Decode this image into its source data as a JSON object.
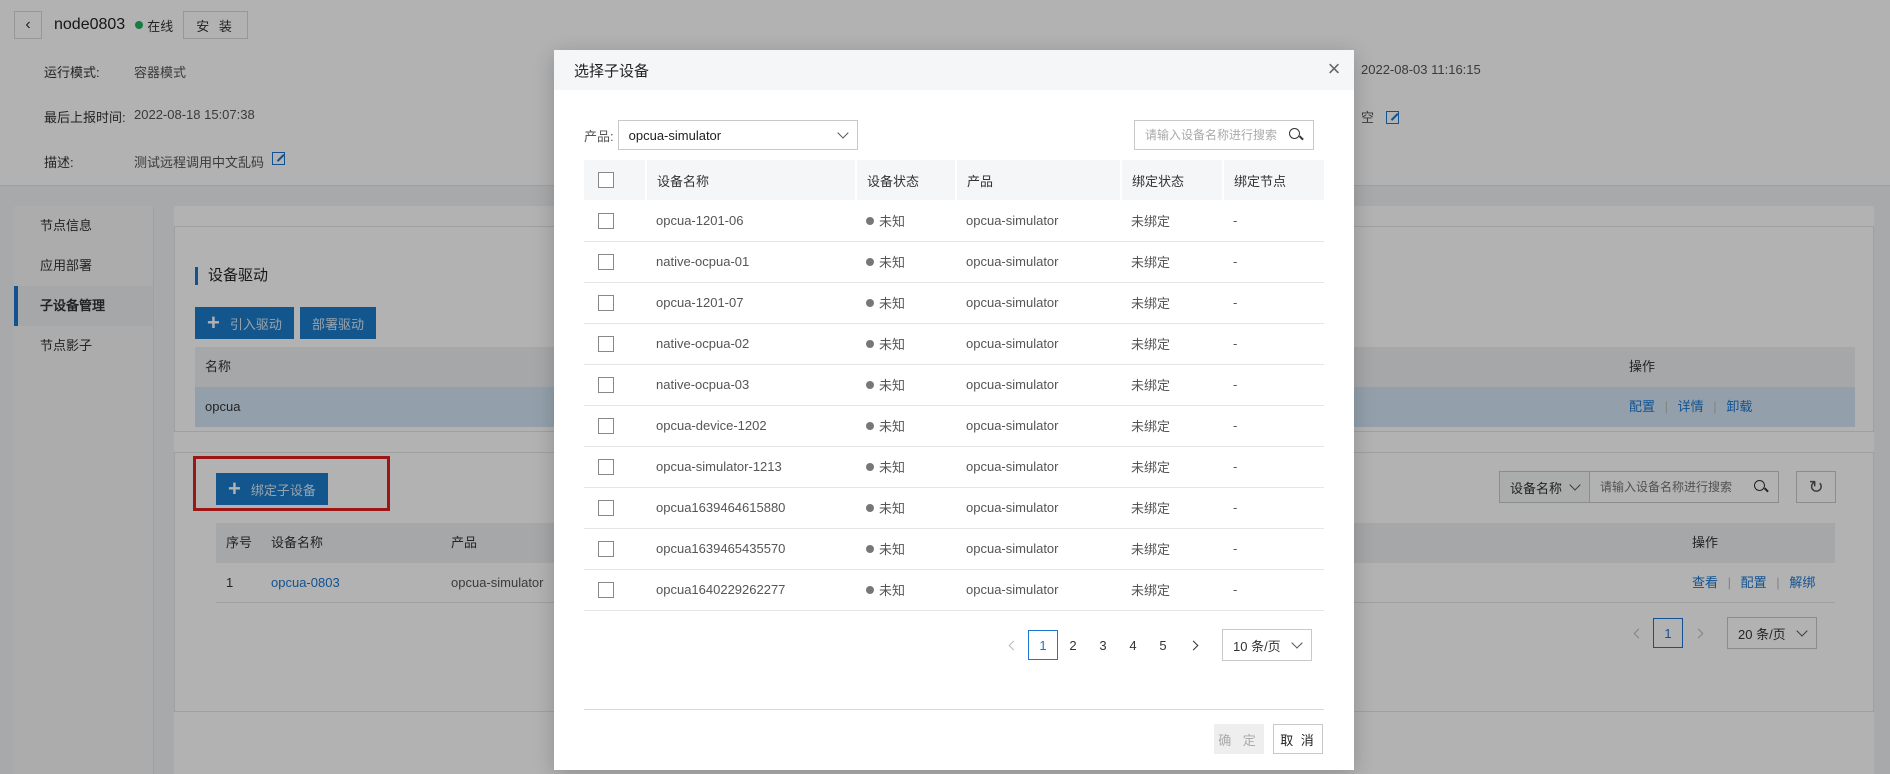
{
  "header": {
    "node_name": "node0803",
    "status": "在线",
    "install_label": "安 装",
    "run_mode_label": "运行模式:",
    "run_mode_value": "容器模式",
    "last_report_label": "最后上报时间:",
    "last_report_value": "2022-08-18 15:07:38",
    "desc_label": "描述:",
    "desc_value": "测试远程调用中文乱码",
    "right_time": "2022-08-03 11:16:15",
    "right_empty": "空"
  },
  "sidebar": {
    "items": [
      {
        "label": "节点信息"
      },
      {
        "label": "应用部署"
      },
      {
        "label": "子设备管理"
      },
      {
        "label": "节点影子"
      }
    ]
  },
  "driver_panel": {
    "title": "设备驱动",
    "import_btn": "引入驱动",
    "deploy_btn": "部署驱动",
    "col_name": "名称",
    "col_ops": "操作",
    "row_name": "opcua",
    "op_config": "配置",
    "op_detail": "详情",
    "op_uninstall": "卸载"
  },
  "subdevice_panel": {
    "bind_btn": "绑定子设备",
    "filter_field": "设备名称",
    "search_placeholder": "请输入设备名称进行搜索",
    "cols": {
      "index": "序号",
      "name": "设备名称",
      "product": "产品",
      "ops": "操作"
    },
    "row": {
      "index": "1",
      "name": "opcua-0803",
      "product": "opcua-simulator"
    },
    "op_view": "查看",
    "op_config": "配置",
    "op_unbind": "解绑",
    "current_page": "1",
    "page_size": "20 条/页"
  },
  "modal": {
    "title": "选择子设备",
    "product_label": "产品:",
    "product_value": "opcua-simulator",
    "search_placeholder": "请输入设备名称进行搜索",
    "columns": [
      "设备名称",
      "设备状态",
      "产品",
      "绑定状态",
      "绑定节点"
    ],
    "rows": [
      {
        "name": "opcua-1201-06",
        "status": "未知",
        "product": "opcua-simulator",
        "bind": "未绑定",
        "node": "-"
      },
      {
        "name": "native-ocpua-01",
        "status": "未知",
        "product": "opcua-simulator",
        "bind": "未绑定",
        "node": "-"
      },
      {
        "name": "opcua-1201-07",
        "status": "未知",
        "product": "opcua-simulator",
        "bind": "未绑定",
        "node": "-"
      },
      {
        "name": "native-ocpua-02",
        "status": "未知",
        "product": "opcua-simulator",
        "bind": "未绑定",
        "node": "-"
      },
      {
        "name": "native-ocpua-03",
        "status": "未知",
        "product": "opcua-simulator",
        "bind": "未绑定",
        "node": "-"
      },
      {
        "name": "opcua-device-1202",
        "status": "未知",
        "product": "opcua-simulator",
        "bind": "未绑定",
        "node": "-"
      },
      {
        "name": "opcua-simulator-1213",
        "status": "未知",
        "product": "opcua-simulator",
        "bind": "未绑定",
        "node": "-"
      },
      {
        "name": "opcua1639464615880",
        "status": "未知",
        "product": "opcua-simulator",
        "bind": "未绑定",
        "node": "-"
      },
      {
        "name": "opcua1639465435570",
        "status": "未知",
        "product": "opcua-simulator",
        "bind": "未绑定",
        "node": "-"
      },
      {
        "name": "opcua1640229262277",
        "status": "未知",
        "product": "opcua-simulator",
        "bind": "未绑定",
        "node": "-"
      }
    ],
    "pages": [
      "1",
      "2",
      "3",
      "4",
      "5"
    ],
    "page_size": "10 条/页",
    "ok_label": "确 定",
    "cancel_label": "取 消"
  }
}
